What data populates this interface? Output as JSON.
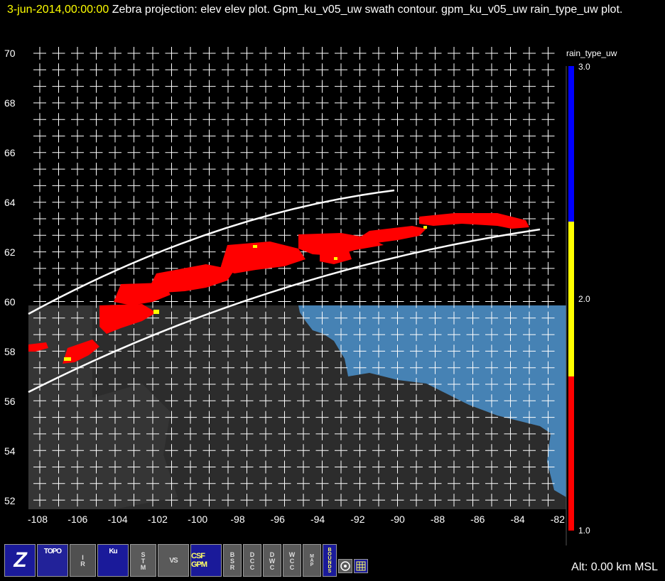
{
  "title": {
    "time": "3-jun-2014,00:00:00",
    "rest": "Zebra projection: elev elev  plot.  Gpm_ku_v05_uw swath contour.  gpm_ku_v05_uw rain_type_uw  plot."
  },
  "axes": {
    "y_ticks": [
      "70",
      "68",
      "66",
      "64",
      "62",
      "60",
      "58",
      "56",
      "54",
      "52"
    ],
    "x_ticks": [
      "-108",
      "-106",
      "-104",
      "-102",
      "-100",
      "-98",
      "-96",
      "-94",
      "-92",
      "-90",
      "-88",
      "-86",
      "-84",
      "-82"
    ]
  },
  "colorbar": {
    "title": "rain_type_uw",
    "labels": [
      "3.0",
      "2.0",
      "1.0"
    ],
    "colors": [
      "#0000ff",
      "#ffff00",
      "#ff0000"
    ]
  },
  "colors": {
    "land": "#2c2c2c",
    "water": "#4682b4",
    "grid": "#ffffff",
    "swath": "#ffffff"
  },
  "toolbar": {
    "buttons": [
      "Z",
      "TOPO",
      "IR",
      "Ku",
      "STM",
      "VS",
      "CSF GPM",
      "BSR",
      "DCC",
      "DWC",
      "WCC",
      "MAP",
      "BOUNDS"
    ]
  },
  "status": {
    "alt": "Alt: 0.00 km MSL"
  }
}
